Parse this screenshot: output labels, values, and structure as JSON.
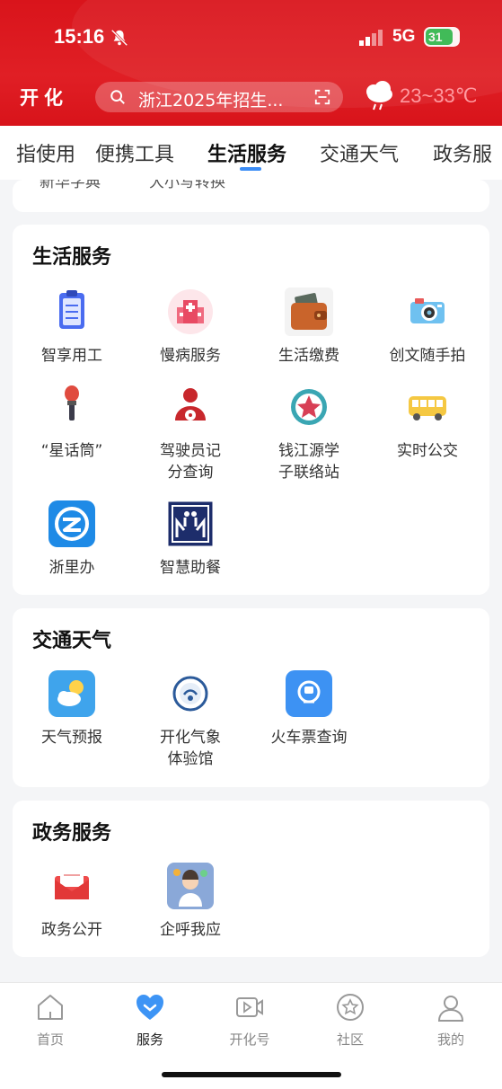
{
  "status_bar": {
    "time": "15:16",
    "network": "5G",
    "battery": "31"
  },
  "header": {
    "logo": "开化",
    "search_text": "浙江2025年招生...",
    "temperature": "23~33℃"
  },
  "tabs": [
    "指使用",
    "便携工具",
    "生活服务",
    "交通天气",
    "政务服"
  ],
  "top_card_clipped": [
    "新华字典",
    "大小写转换"
  ],
  "life_section": {
    "title": "生活服务",
    "items": [
      "智享用工",
      "慢病服务",
      "生活缴费",
      "创文随手拍",
      "“星话筒”",
      "驾驶员记\n分查询",
      "钱江源学\n子联络站",
      "实时公交",
      "浙里办",
      "智慧助餐"
    ]
  },
  "traffic_section": {
    "title": "交通天气",
    "items": [
      "天气预报",
      "开化气象\n体验馆",
      "火车票查询"
    ]
  },
  "gov_section": {
    "title": "政务服务",
    "items": [
      "政务公开",
      "企呼我应"
    ]
  },
  "bottom_nav": [
    "首页",
    "服务",
    "开化号",
    "社区",
    "我的"
  ],
  "colors": {
    "brand_red": "#d9141b",
    "accent_blue": "#3b8cf5"
  }
}
